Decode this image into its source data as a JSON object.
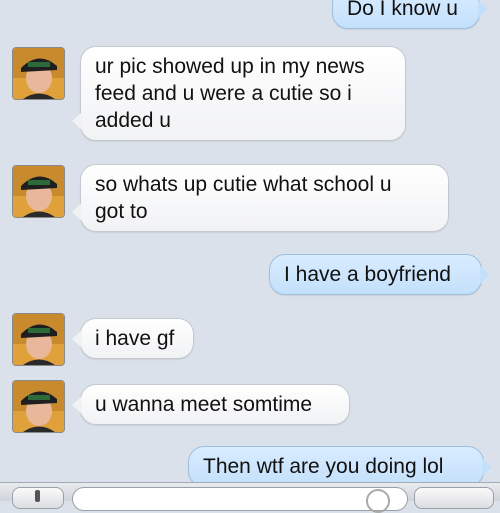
{
  "conversation": {
    "messages": [
      {
        "sender": "me",
        "lines": [
          "Do I know u"
        ]
      },
      {
        "sender": "them",
        "avatar": "profile-photo-icon",
        "lines": [
          "ur pic showed up in my news",
          "feed and u were a cutie so i",
          "added u"
        ]
      },
      {
        "sender": "them",
        "avatar": "profile-photo-icon",
        "lines": [
          "so whats up cutie what school u",
          "got to"
        ]
      },
      {
        "sender": "me",
        "lines": [
          "I have a boyfriend"
        ]
      },
      {
        "sender": "them",
        "avatar": "profile-photo-icon",
        "lines": [
          "i have gf"
        ]
      },
      {
        "sender": "them",
        "avatar": "profile-photo-icon",
        "lines": [
          "u wanna meet somtime"
        ]
      },
      {
        "sender": "me",
        "lines": [
          "Then wtf are you doing lol"
        ]
      }
    ]
  },
  "input_bar": {
    "message_value": "",
    "message_placeholder": ""
  },
  "colors": {
    "background": "#dbe1ea",
    "incoming_bubble": "#ffffff",
    "outgoing_bubble": "#c9e4fc"
  }
}
